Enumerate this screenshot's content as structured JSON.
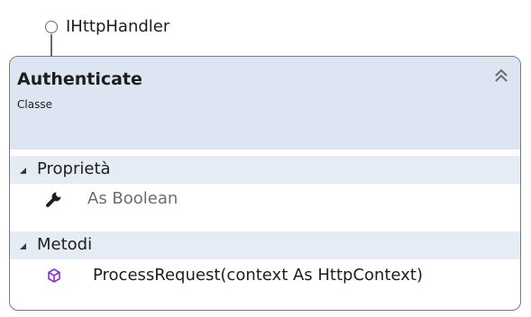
{
  "interface": {
    "name": "IHttpHandler"
  },
  "class": {
    "name": "Authenticate",
    "stereotype": "Classe",
    "collapse_icon": "double-chevron-up-icon"
  },
  "sections": {
    "properties": {
      "label": "Proprietà",
      "items": [
        {
          "label": "As Boolean",
          "icon": "wrench-icon"
        }
      ]
    },
    "methods": {
      "label": "Metodi",
      "items": [
        {
          "label": "ProcessRequest(context As HttpContext)",
          "icon": "method-cube-icon"
        }
      ]
    }
  },
  "colors": {
    "header_bg": "#dde5f2",
    "section_bg": "#e6ecf6",
    "border": "#7a7a7a",
    "method_icon": "#8a2be2",
    "property_text": "#6d6d6d"
  }
}
